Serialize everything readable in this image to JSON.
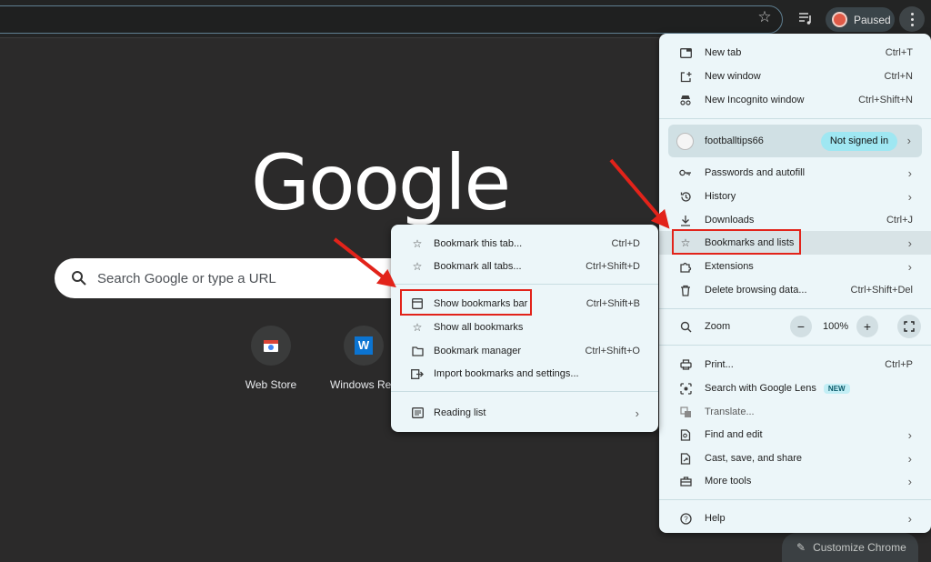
{
  "toolbar": {
    "paused_label": "Paused"
  },
  "page": {
    "logo": "Google",
    "search_placeholder": "Search Google or type a URL",
    "shortcuts": [
      {
        "label": "Web Store"
      },
      {
        "label": "Windows Rep"
      }
    ],
    "customize_label": "Customize Chrome"
  },
  "main_menu": {
    "new_tab": {
      "label": "New tab",
      "shortcut": "Ctrl+T"
    },
    "new_window": {
      "label": "New window",
      "shortcut": "Ctrl+N"
    },
    "new_incognito": {
      "label": "New Incognito window",
      "shortcut": "Ctrl+Shift+N"
    },
    "profile": {
      "name": "footballtips66",
      "status": "Not signed in"
    },
    "passwords": {
      "label": "Passwords and autofill"
    },
    "history": {
      "label": "History"
    },
    "downloads": {
      "label": "Downloads",
      "shortcut": "Ctrl+J"
    },
    "bookmarks": {
      "label": "Bookmarks and lists"
    },
    "extensions": {
      "label": "Extensions"
    },
    "delete_data": {
      "label": "Delete browsing data...",
      "shortcut": "Ctrl+Shift+Del"
    },
    "zoom": {
      "label": "Zoom",
      "value": "100%",
      "minus": "−",
      "plus": "+"
    },
    "print": {
      "label": "Print...",
      "shortcut": "Ctrl+P"
    },
    "lens": {
      "label": "Search with Google Lens",
      "badge": "NEW"
    },
    "translate": {
      "label": "Translate..."
    },
    "find_edit": {
      "label": "Find and edit"
    },
    "cast": {
      "label": "Cast, save, and share"
    },
    "more_tools": {
      "label": "More tools"
    },
    "help": {
      "label": "Help"
    }
  },
  "bookmarks_submenu": {
    "bookmark_tab": {
      "label": "Bookmark this tab...",
      "shortcut": "Ctrl+D"
    },
    "bookmark_all": {
      "label": "Bookmark all tabs...",
      "shortcut": "Ctrl+Shift+D"
    },
    "show_bar": {
      "label": "Show bookmarks bar",
      "shortcut": "Ctrl+Shift+B"
    },
    "show_all": {
      "label": "Show all bookmarks"
    },
    "manager": {
      "label": "Bookmark manager",
      "shortcut": "Ctrl+Shift+O"
    },
    "import": {
      "label": "Import bookmarks and settings..."
    },
    "reading_list": {
      "label": "Reading list"
    }
  },
  "colors": {
    "annotation_red": "#e2231a",
    "menu_bg": "#ecf6f9",
    "page_bg": "#2b2a2a"
  }
}
